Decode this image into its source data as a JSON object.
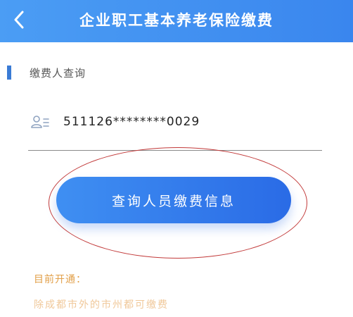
{
  "header": {
    "title": "企业职工基本养老保险缴费",
    "back_icon": "chevron-left-icon"
  },
  "section": {
    "title": "缴费人查询"
  },
  "id_field": {
    "icon": "person-card-icon",
    "value": "511126********0029"
  },
  "query_button": {
    "label": "查询人员缴费信息"
  },
  "notice": {
    "title": "目前开通：",
    "text": "除成都市外的市州都可缴费"
  },
  "colors": {
    "header": "#3a86ee",
    "accent": "#3a7bd5",
    "annotation_circle": "#c23a3a",
    "notice_title": "#e2a04a",
    "notice_text": "#f0c89a"
  }
}
